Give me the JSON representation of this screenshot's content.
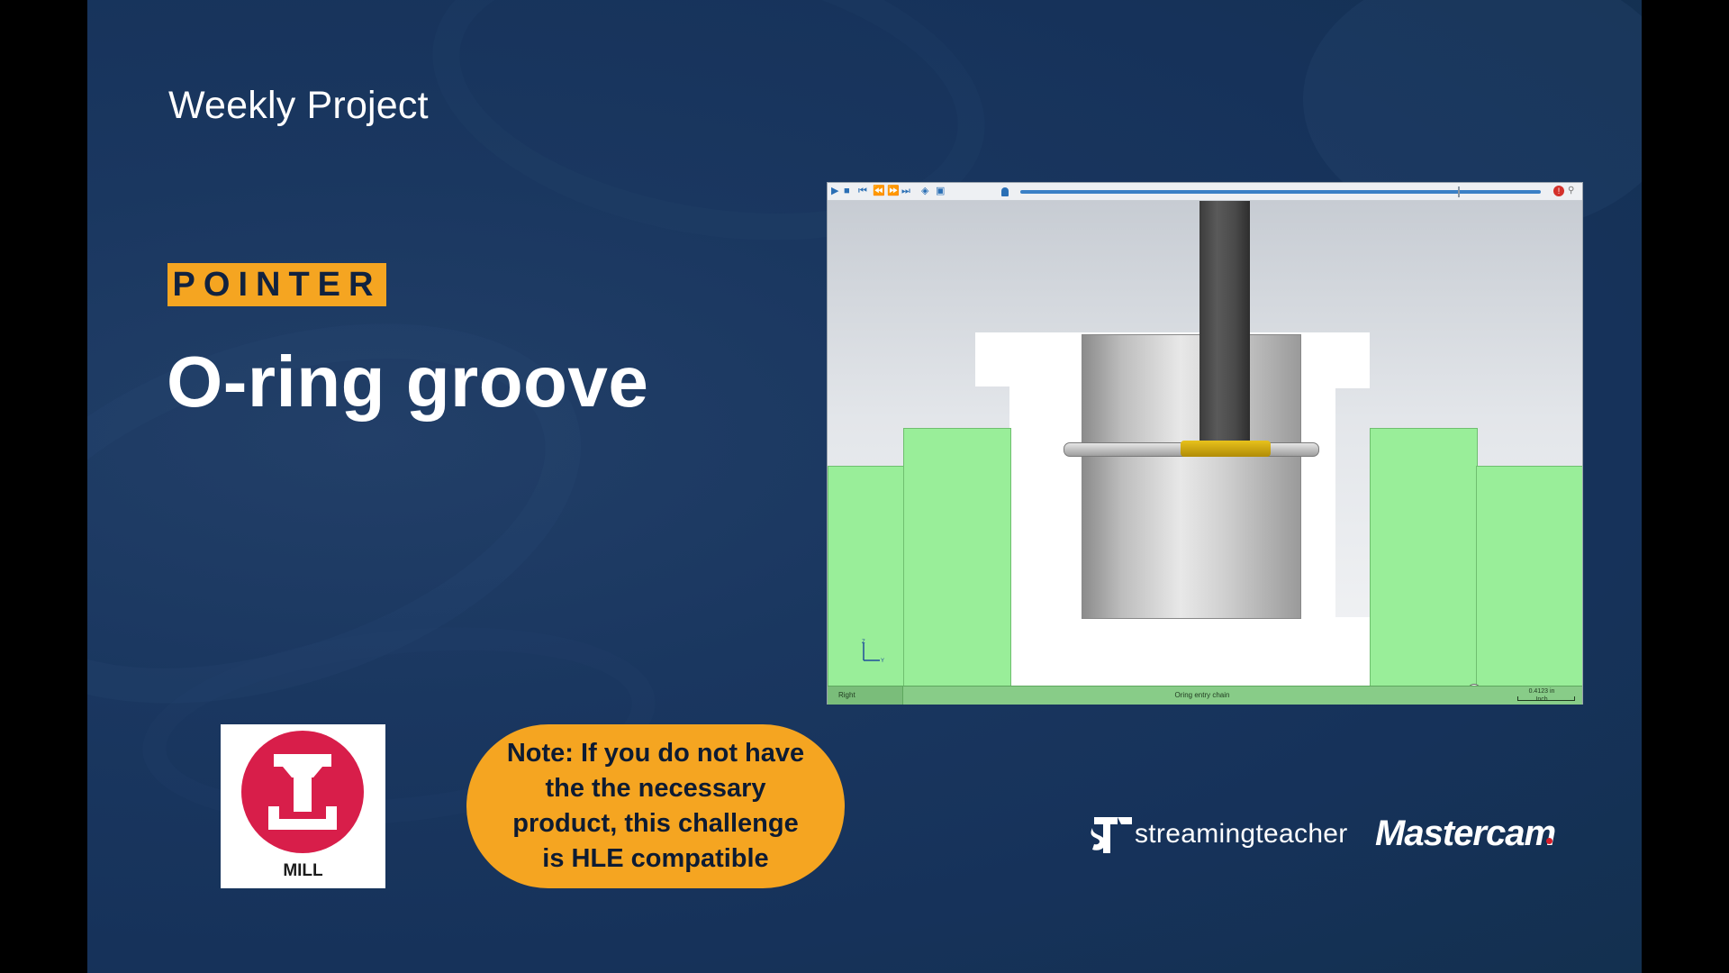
{
  "slide": {
    "header": "Weekly Project",
    "tag": "POINTER",
    "title": "O-ring groove",
    "note": "Note: If you do not have the the necessary product, this challenge is HLE compatible",
    "badge": {
      "label": "MILL",
      "icon": "mill-tee-icon",
      "color": "#d81e4a"
    },
    "brands": {
      "streaming": "streamingteacher",
      "mastercam": "Mastercam"
    },
    "accent": "#f5a521",
    "background": "#1a3760"
  },
  "viewer": {
    "toolbar": {
      "buttons": [
        "play-icon",
        "stop-icon",
        "first-icon",
        "step-back-icon",
        "step-forward-icon",
        "last-icon",
        "view-icon",
        "options-icon"
      ],
      "progress": 0.84
    },
    "axes": {
      "z": "Z",
      "y": "Y"
    },
    "status": {
      "view": "Right",
      "operation": "Oring entry chain",
      "scale_value": "0.4123 in",
      "scale_unit": "Inch"
    }
  }
}
